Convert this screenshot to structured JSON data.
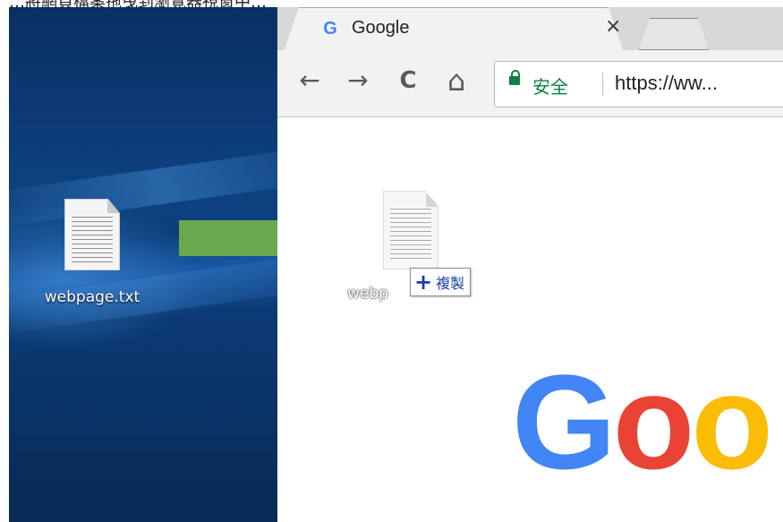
{
  "caption": {
    "text": "…將網頁檔案拖曳到瀏覽器視窗中…"
  },
  "desktop": {
    "file_label": "webpage.txt",
    "file_icon": "text-file-icon"
  },
  "browser": {
    "tab": {
      "favicon": "G",
      "title": "Google",
      "close_glyph": "×"
    },
    "toolbar": {
      "back_glyph": "←",
      "forward_glyph": "→",
      "reload_glyph": "C",
      "home_glyph": "⌂"
    },
    "omnibox": {
      "secure_label": "安全",
      "url": "https://ww..."
    },
    "content": {
      "drag_label": "webp",
      "copy_plus": "+",
      "copy_text": "複製",
      "logo_letters": [
        {
          "char": "G",
          "color": "#4285F4"
        },
        {
          "char": "o",
          "color": "#EA4335"
        },
        {
          "char": "o",
          "color": "#FBBC05"
        }
      ]
    }
  },
  "colors": {
    "arrow": "#6AA84F",
    "secure_green": "#0B8043",
    "copy_blue": "#1A3FA6"
  }
}
